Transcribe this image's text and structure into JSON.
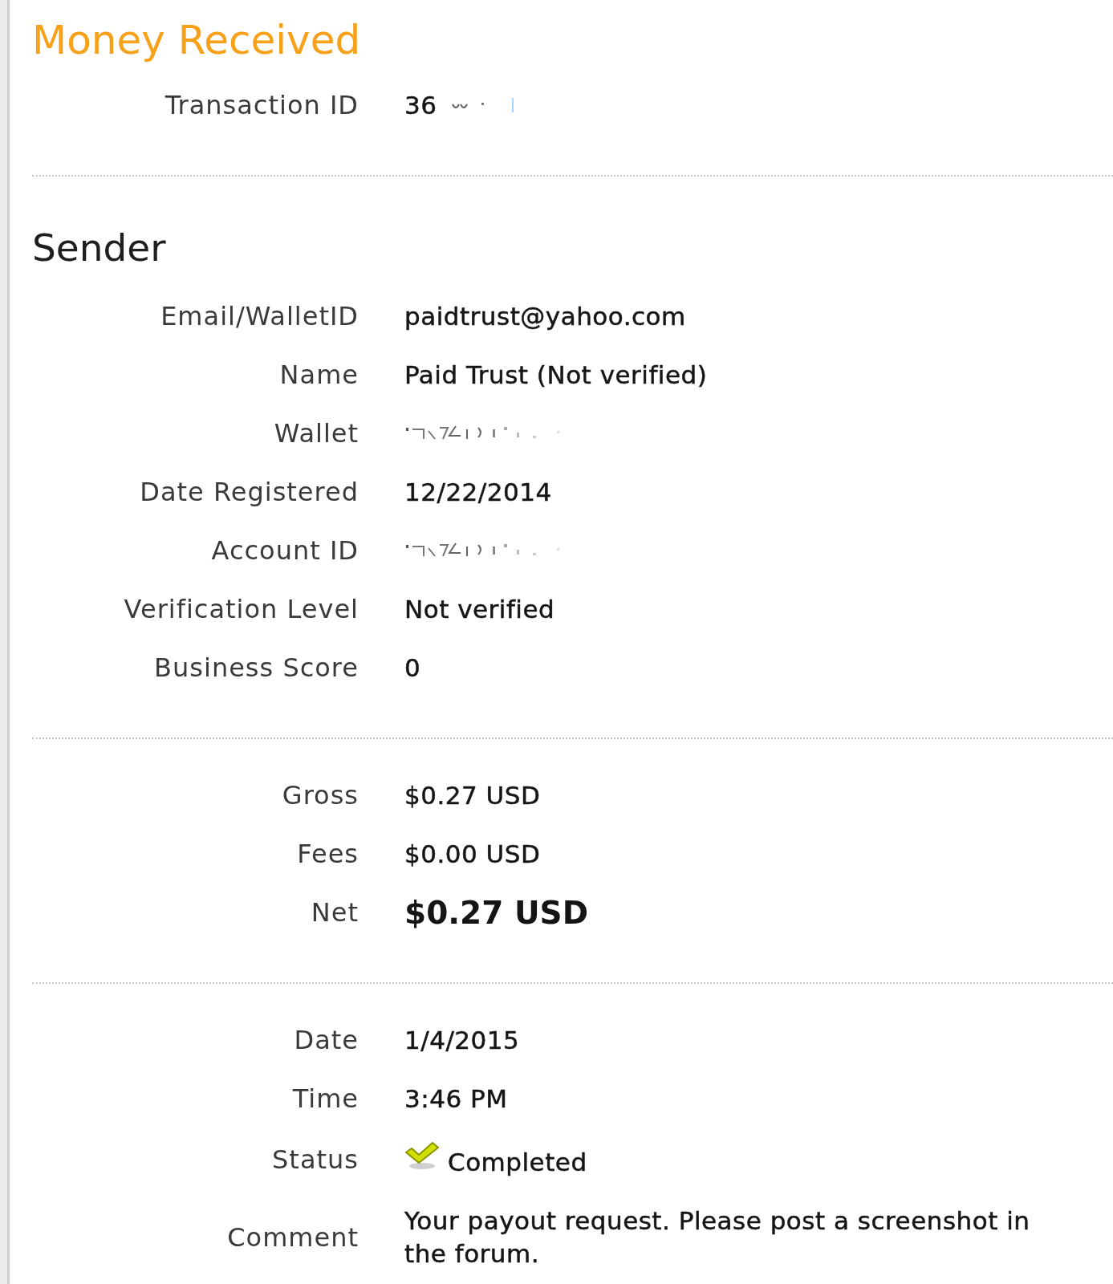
{
  "title": "Money Received",
  "sections": [
    {
      "rows": [
        {
          "kind": "redacted",
          "label": "Transaction ID",
          "value": "36"
        }
      ]
    },
    {
      "heading": "Sender",
      "rows": [
        {
          "kind": "text",
          "label": "Email/WalletID",
          "value": "paidtrust@yahoo.com"
        },
        {
          "kind": "text",
          "label": "Name",
          "value": "Paid Trust (Not verified)"
        },
        {
          "kind": "redacted",
          "label": "Wallet"
        },
        {
          "kind": "text",
          "label": "Date Registered",
          "value": "12/22/2014"
        },
        {
          "kind": "redacted",
          "label": "Account ID"
        },
        {
          "kind": "text",
          "label": "Verification Level",
          "value": "Not verified"
        },
        {
          "kind": "text",
          "label": "Business Score",
          "value": "0"
        }
      ]
    },
    {
      "rows": [
        {
          "kind": "text",
          "label": "Gross",
          "value": "$0.27 USD"
        },
        {
          "kind": "text",
          "label": "Fees",
          "value": "$0.00 USD"
        },
        {
          "kind": "total",
          "label": "Net",
          "value": "$0.27 USD"
        }
      ]
    },
    {
      "rows": [
        {
          "kind": "text",
          "label": "Date",
          "value": "1/4/2015"
        },
        {
          "kind": "text",
          "label": "Time",
          "value": "3:46 PM"
        },
        {
          "kind": "status",
          "label": "Status",
          "value": "Completed"
        },
        {
          "kind": "text",
          "label": "Comment",
          "value": "Your payout request. Please post a screenshot in the forum."
        }
      ]
    }
  ]
}
